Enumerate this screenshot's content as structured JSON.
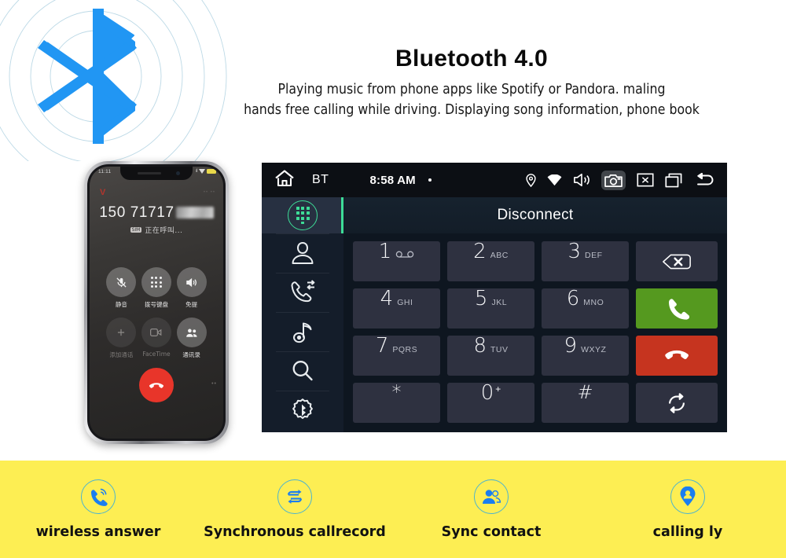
{
  "headline": {
    "title": "Bluetooth 4.0",
    "line1": "Playing music from phone apps like Spotify or Pandora. maling",
    "line2": "hands free calling while driving. Displaying  song information, phone book"
  },
  "colors": {
    "bluetooth_blue": "#2196f3",
    "accent_green": "#3ddc97",
    "call_green": "#55991f",
    "hangup_red": "#c6341f",
    "banner_yellow": "#fdee53",
    "feature_icon_blue": "#1a7ef0",
    "feature_ring": "#4bb3cf"
  },
  "phone": {
    "status_time": "11:11",
    "status_signal": "ıl",
    "number": "150 71717",
    "number_masked": true,
    "sim_tag": "SIM",
    "call_state": "正在呼叫...",
    "brand_mark": "V",
    "top_right_mark": "•• ••",
    "side_mark": "••",
    "buttons": [
      {
        "name": "mute",
        "label": "静音",
        "icon": "mic-off-icon",
        "dim": false
      },
      {
        "name": "keypad",
        "label": "拨号键盘",
        "icon": "keypad-icon",
        "dim": false
      },
      {
        "name": "speaker",
        "label": "免提",
        "icon": "speaker-icon",
        "dim": false
      },
      {
        "name": "add-call",
        "label": "添加通话",
        "icon": "plus-icon",
        "dim": true
      },
      {
        "name": "facetime",
        "label": "FaceTime",
        "icon": "facetime-icon",
        "dim": true
      },
      {
        "name": "contacts",
        "label": "通讯录",
        "icon": "contacts-icon",
        "dim": false
      }
    ],
    "end_call": "end-call-icon"
  },
  "headunit": {
    "topbar": {
      "home": "home-icon",
      "source": "BT",
      "clock": "8:58 AM",
      "dot": "",
      "icons": [
        {
          "name": "location-icon",
          "active": false
        },
        {
          "name": "wifi-icon",
          "active": false
        },
        {
          "name": "volume-icon",
          "active": false
        },
        {
          "name": "screenshot-camera-icon",
          "active": true
        },
        {
          "name": "close-box-icon",
          "active": false
        },
        {
          "name": "recent-apps-icon",
          "active": false
        },
        {
          "name": "back-icon",
          "active": false
        }
      ]
    },
    "sidebar": [
      {
        "name": "dialer",
        "icon": "dialpad-icon",
        "selected": true
      },
      {
        "name": "contacts",
        "icon": "contact-person-icon",
        "selected": false
      },
      {
        "name": "call-history",
        "icon": "call-transfer-icon",
        "selected": false
      },
      {
        "name": "music",
        "icon": "music-note-icon",
        "selected": false
      },
      {
        "name": "search",
        "icon": "search-icon",
        "selected": false
      },
      {
        "name": "bluetooth-settings",
        "icon": "bluetooth-gear-icon",
        "selected": false
      }
    ],
    "header_label": "Disconnect",
    "keys": [
      {
        "num": "1",
        "sub": "",
        "icon": "voicemail-icon"
      },
      {
        "num": "2",
        "sub": "ABC",
        "icon": ""
      },
      {
        "num": "3",
        "sub": "DEF",
        "icon": ""
      },
      {
        "num": "4",
        "sub": "GHI",
        "icon": ""
      },
      {
        "num": "5",
        "sub": "JKL",
        "icon": ""
      },
      {
        "num": "6",
        "sub": "MNO",
        "icon": ""
      },
      {
        "num": "7",
        "sub": "PQRS",
        "icon": ""
      },
      {
        "num": "8",
        "sub": "TUV",
        "icon": ""
      },
      {
        "num": "9",
        "sub": "WXYZ",
        "icon": ""
      },
      {
        "num": "*",
        "sub": "",
        "icon": ""
      },
      {
        "num": "0",
        "sup": "+",
        "sub": "",
        "icon": ""
      },
      {
        "num": "#",
        "sub": "",
        "icon": ""
      }
    ],
    "actions": [
      {
        "name": "backspace",
        "icon": "backspace-icon",
        "style": "default"
      },
      {
        "name": "dial",
        "icon": "call-icon",
        "style": "call"
      },
      {
        "name": "hangup",
        "icon": "hangup-icon",
        "style": "hang"
      },
      {
        "name": "switch",
        "icon": "sync-switch-icon",
        "style": "default"
      }
    ]
  },
  "features": [
    {
      "label": "wireless answer",
      "icon": "call-wireless-icon"
    },
    {
      "label": "Synchronous callrecord",
      "icon": "sync-loop-icon"
    },
    {
      "label": "Sync contact",
      "icon": "contacts-sync-icon"
    },
    {
      "label": "calling ly",
      "icon": "caller-location-icon"
    }
  ]
}
